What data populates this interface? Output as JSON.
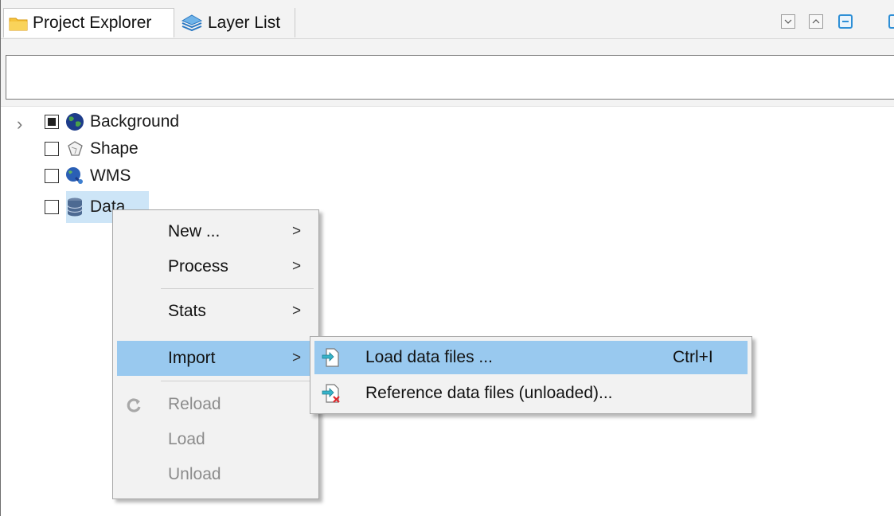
{
  "tabs": [
    {
      "label": "Project Explorer",
      "icon": "folder-icon",
      "active": true
    },
    {
      "label": "Layer List",
      "icon": "layers-icon",
      "active": false
    }
  ],
  "window_buttons": [
    "minimize-icon",
    "maximize-icon",
    "restore-icon"
  ],
  "filter": {
    "value": "",
    "placeholder": ""
  },
  "tree": {
    "items": [
      {
        "label": "Background",
        "icon": "globe-icon",
        "checkbox": "partial",
        "expandable": true
      },
      {
        "label": "Shape",
        "icon": "shape-icon",
        "checkbox": "unchecked",
        "expandable": false
      },
      {
        "label": "WMS",
        "icon": "wms-icon",
        "checkbox": "unchecked",
        "expandable": false
      },
      {
        "label": "Data",
        "icon": "database-icon",
        "checkbox": "unchecked",
        "expandable": false,
        "selected": true
      }
    ]
  },
  "context_menu": {
    "items": [
      {
        "label": "New ...",
        "submenu": true,
        "enabled": true
      },
      {
        "label": "Process",
        "submenu": true,
        "enabled": true
      },
      {
        "label": "Stats",
        "submenu": true,
        "enabled": true
      },
      {
        "label": "Import",
        "submenu": true,
        "enabled": true,
        "active": true
      },
      {
        "label": "Reload",
        "submenu": false,
        "enabled": false,
        "icon": "reload-icon"
      },
      {
        "label": "Load",
        "submenu": false,
        "enabled": false
      },
      {
        "label": "Unload",
        "submenu": false,
        "enabled": false
      }
    ],
    "arrow": ">"
  },
  "import_submenu": {
    "items": [
      {
        "label": "Load data files ...",
        "shortcut": "Ctrl+I",
        "icon": "load-file-icon",
        "active": true
      },
      {
        "label": "Reference data files (unloaded)...",
        "shortcut": "",
        "icon": "reference-file-icon",
        "active": false
      }
    ]
  },
  "colors": {
    "menu_highlight": "#99c9ef",
    "selection": "#cde5f7",
    "accent": "#2e8fd6",
    "disabled_text": "#8c8c8c"
  }
}
